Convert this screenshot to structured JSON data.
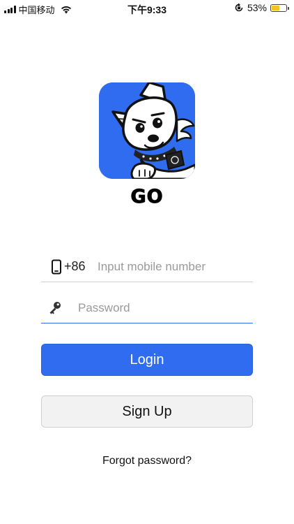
{
  "status_bar": {
    "carrier": "中国移动",
    "time": "下午9:33",
    "battery_percent_label": "53%",
    "battery_level": 0.53,
    "icons": [
      "signal-icon",
      "wifi-icon",
      "orientation-lock-icon",
      "battery-icon"
    ]
  },
  "app": {
    "name": "GO",
    "logo_icon": "dog-mascot-icon",
    "brand_color": "#2f6cf0"
  },
  "form": {
    "phone": {
      "icon": "phone-icon",
      "country_code": "+86",
      "placeholder": "Input mobile number",
      "value": ""
    },
    "password": {
      "icon": "key-icon",
      "placeholder": "Password",
      "value": ""
    }
  },
  "actions": {
    "login_label": "Login",
    "signup_label": "Sign Up",
    "forgot_label": "Forgot password?"
  }
}
